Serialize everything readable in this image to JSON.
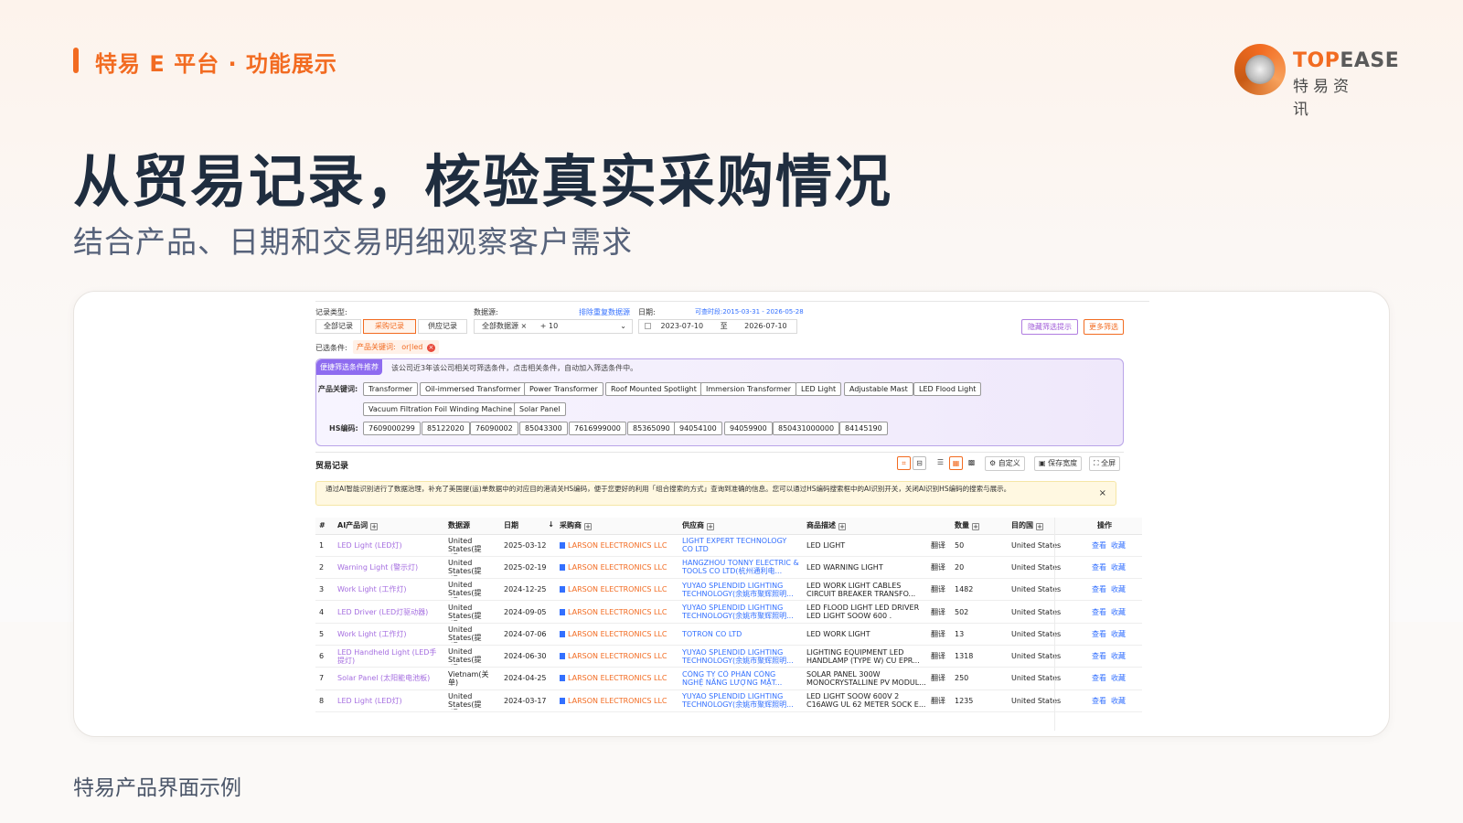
{
  "brand": {
    "label": "特易 E 平台 · 功能展示",
    "accent": "#f26b21"
  },
  "logo": {
    "word_main": "TOP",
    "word_rest": "EASE",
    "sub": "特易资讯"
  },
  "headline": "从贸易记录，核验真实采购情况",
  "subhead": "结合产品、日期和交易明细观察客户需求",
  "caption": "特易产品界面示例",
  "app": {
    "record_type_label": "记录类型:",
    "record_types": [
      "全部记录",
      "采购记录",
      "供应记录"
    ],
    "datasource_label": "数据源:",
    "dedupe_link": "排除重复数据源",
    "datasource_value": "全部数据源",
    "datasource_more": "+ 10",
    "date_label": "日期:",
    "date_range_hint": "可查时段:2015-03-31 - 2026-05-28",
    "date_from": "2023-07-10",
    "date_to_label": "至",
    "date_to": "2026-07-10",
    "hide_tips_button": "隐藏筛选提示",
    "more_filters_button": "更多筛选",
    "filter_label": "已选条件:",
    "filter_chip_key": "产品关键词:",
    "filter_chip_value": "or|led",
    "recommend_tag": "便捷筛选条件推荐",
    "recommend_desc": "该公司近3年该公司相关可筛选条件，点击相关条件，自动加入筛选条件中。",
    "keyword_label": "产品关键词:",
    "keywords": [
      "Transformer",
      "Oil-immersed Transformer",
      "Power Transformer",
      "Roof Mounted Spotlight",
      "Immersion Transformer",
      "LED Light",
      "Adjustable Mast",
      "LED Flood Light",
      "Vacuum Filtration Foil Winding Machine",
      "Solar Panel"
    ],
    "hs_label": "HS编码:",
    "hs_codes": [
      "7609000299",
      "85122020",
      "76090002",
      "85043300",
      "7616999000",
      "85365090",
      "94054100",
      "94059900",
      "850431000000",
      "84145190"
    ],
    "section_title": "贸易记录",
    "toolbar": {
      "customize": "自定义",
      "save_width": "保存宽度",
      "fullscreen": "全屏"
    },
    "notice": "通过AI智能识别进行了数据治理，补充了美国提(运)单数据中的对应目的港清关HS编码，便于您更好的利用「组合搜索的方式」查询到准确的信息。您可以通过HS编码搜索框中的AI识别开关，关闭AI识别HS编码的搜索与展示。",
    "columns": [
      "#",
      "AI产品词",
      "数据源",
      "日期",
      "采购商",
      "供应商",
      "商品描述",
      "",
      "数量",
      "目的国",
      "操作"
    ],
    "translate_label": "翻译",
    "view_label": "查看",
    "fav_label": "收藏",
    "rows": [
      {
        "n": "1",
        "product": "LED Light (LED灯)",
        "source": "United States(提(运...",
        "date": "2025-03-12",
        "buyer": "LARSON ELECTRONICS LLC",
        "supplier": "LIGHT EXPERT TECHNOLOGY CO LTD",
        "desc": "LED LIGHT",
        "qty": "50",
        "dest": "United States"
      },
      {
        "n": "2",
        "product": "Warning Light (警示灯)",
        "source": "United States(提(运...",
        "date": "2025-02-19",
        "buyer": "LARSON ELECTRONICS LLC",
        "supplier": "HANGZHOU TONNY ELECTRIC & TOOLS CO LTD(杭州通利电...",
        "desc": "LED WARNING LIGHT",
        "qty": "20",
        "dest": "United States"
      },
      {
        "n": "3",
        "product": "Work Light (工作灯)",
        "source": "United States(提(运...",
        "date": "2024-12-25",
        "buyer": "LARSON ELECTRONICS LLC",
        "supplier": "YUYAO SPLENDID LIGHTING TECHNOLOGY(余姚市聚辉照明...",
        "desc": "LED WORK LIGHT CABLES CIRCUIT BREAKER TRANSFO...",
        "qty": "1482",
        "dest": "United States"
      },
      {
        "n": "4",
        "product": "LED Driver (LED灯驱动器)",
        "source": "United States(提(运...",
        "date": "2024-09-05",
        "buyer": "LARSON ELECTRONICS LLC",
        "supplier": "YUYAO SPLENDID LIGHTING TECHNOLOGY(余姚市聚辉照明...",
        "desc": "LED FLOOD LIGHT LED DRIVER LED LIGHT SOOW 600 .",
        "qty": "502",
        "dest": "United States"
      },
      {
        "n": "5",
        "product": "Work Light (工作灯)",
        "source": "United States(提(运...",
        "date": "2024-07-06",
        "buyer": "LARSON ELECTRONICS LLC",
        "supplier": "TOTRON CO LTD",
        "desc": "LED WORK LIGHT",
        "qty": "13",
        "dest": "United States"
      },
      {
        "n": "6",
        "product": "LED Handheld Light (LED手提灯)",
        "source": "United States(提(运...",
        "date": "2024-06-30",
        "buyer": "LARSON ELECTRONICS LLC",
        "supplier": "YUYAO SPLENDID LIGHTING TECHNOLOGY(余姚市聚辉照明...",
        "desc": "LIGHTING EQUIPMENT LED HANDLAMP (TYPE W) CU EPR...",
        "qty": "1318",
        "dest": "United States"
      },
      {
        "n": "7",
        "product": "Solar Panel (太阳能电池板)",
        "source": "Vietnam(关单)",
        "date": "2024-04-25",
        "buyer": "LARSON ELECTRONICS LLC",
        "supplier": "CÔNG TY CỔ PHẦN CÔNG NGHỆ NĂNG LƯỢNG MẶT...",
        "desc": "SOLAR PANEL 300W MONOCRYSTALLINE PV MODUL...",
        "qty": "250",
        "dest": "United States"
      },
      {
        "n": "8",
        "product": "LED Light (LED灯)",
        "source": "United States(提(运...",
        "date": "2024-03-17",
        "buyer": "LARSON ELECTRONICS LLC",
        "supplier": "YUYAO SPLENDID LIGHTING TECHNOLOGY(余姚市聚辉照明...",
        "desc": "LED LIGHT SOOW 600V 2 C16AWG UL 62 METER SOCK E...",
        "qty": "1235",
        "dest": "United States"
      }
    ]
  }
}
